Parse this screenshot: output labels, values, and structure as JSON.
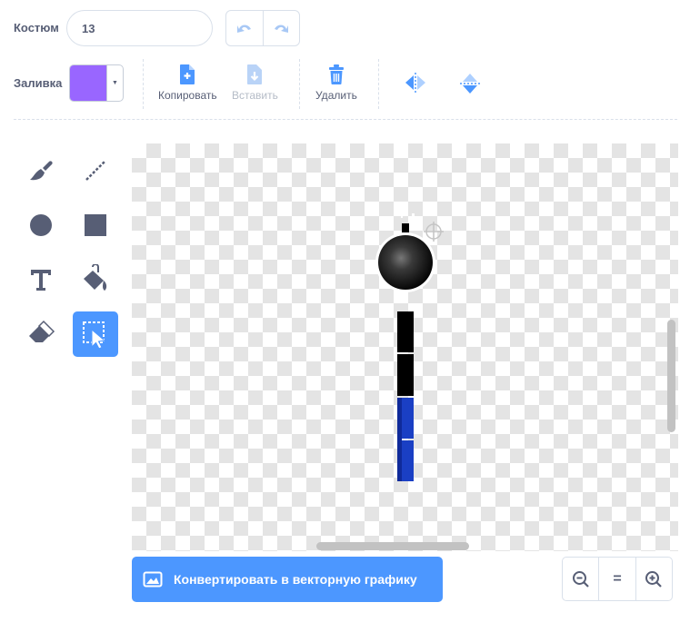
{
  "costume": {
    "label": "Костюм",
    "value": "13"
  },
  "fill": {
    "label": "Заливка",
    "color": "#9966ff"
  },
  "toolbar": {
    "copy_label": "Копировать",
    "paste_label": "Вставить",
    "delete_label": "Удалить"
  },
  "tools": [
    {
      "name": "brush",
      "icon": "brush-icon"
    },
    {
      "name": "line",
      "icon": "line-icon"
    },
    {
      "name": "circle",
      "icon": "circle-icon"
    },
    {
      "name": "rectangle",
      "icon": "rectangle-icon"
    },
    {
      "name": "text",
      "icon": "text-icon"
    },
    {
      "name": "fill",
      "icon": "fill-bucket-icon"
    },
    {
      "name": "eraser",
      "icon": "eraser-icon"
    },
    {
      "name": "select",
      "icon": "select-icon",
      "active": true
    }
  ],
  "convert_button": {
    "label": "Конвертировать в векторную графику"
  },
  "zoom": {
    "zoom_out": "zoom-out-icon",
    "reset_label": "=",
    "zoom_in": "zoom-in-icon"
  },
  "colors": {
    "accent": "#4c97ff",
    "text": "#575e75",
    "disabled": "#b5bcc7",
    "sprite_blue": "#1a3fc4"
  }
}
